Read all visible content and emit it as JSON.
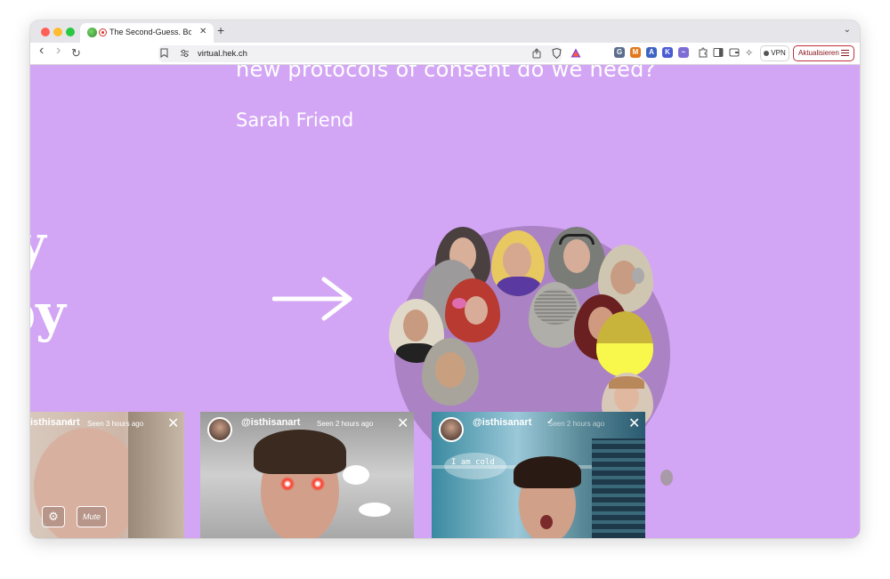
{
  "browser": {
    "tab_title": "The Second-Guess. Body",
    "tab_close": "✕",
    "new_tab": "+",
    "tab_menu": "⌄",
    "url": "virtual.hek.ch",
    "back": "‹",
    "forward": "›",
    "reload": "↻",
    "vpn_label": "VPN",
    "update_label": "Aktualisieren",
    "extensions": [
      {
        "name": "shield-extension",
        "color": "#5a6d8c",
        "glyph": "G"
      },
      {
        "name": "metamask-extension",
        "color": "#e2761b",
        "glyph": "M"
      },
      {
        "name": "ext-blue",
        "color": "#3d64c2",
        "glyph": "A"
      },
      {
        "name": "k-extension",
        "color": "#4a5bd4",
        "glyph": "K"
      },
      {
        "name": "bird-extension",
        "color": "#7d6ed6",
        "glyph": "~"
      }
    ]
  },
  "page": {
    "question_fragment": "new protocols of consent do we need?",
    "author": "Sarah Friend",
    "title_line_1": "y",
    "title_line_2": "aby"
  },
  "cards": [
    {
      "username": "isthisanart",
      "seen": "Seen 3 hours ago",
      "close": "✕",
      "settings_icon": "⚙",
      "mute_label": "Mute"
    },
    {
      "username": "@isthisanart",
      "seen": "Seen 2 hours ago",
      "close": "✕"
    },
    {
      "username": "@isthisanart",
      "seen": "Seen 2 hours ago",
      "close": "✕",
      "speech": "I am cold"
    }
  ],
  "colors": {
    "background": "#d3a6f5",
    "circle": "#ab82c4",
    "update_border": "#c0303a"
  }
}
